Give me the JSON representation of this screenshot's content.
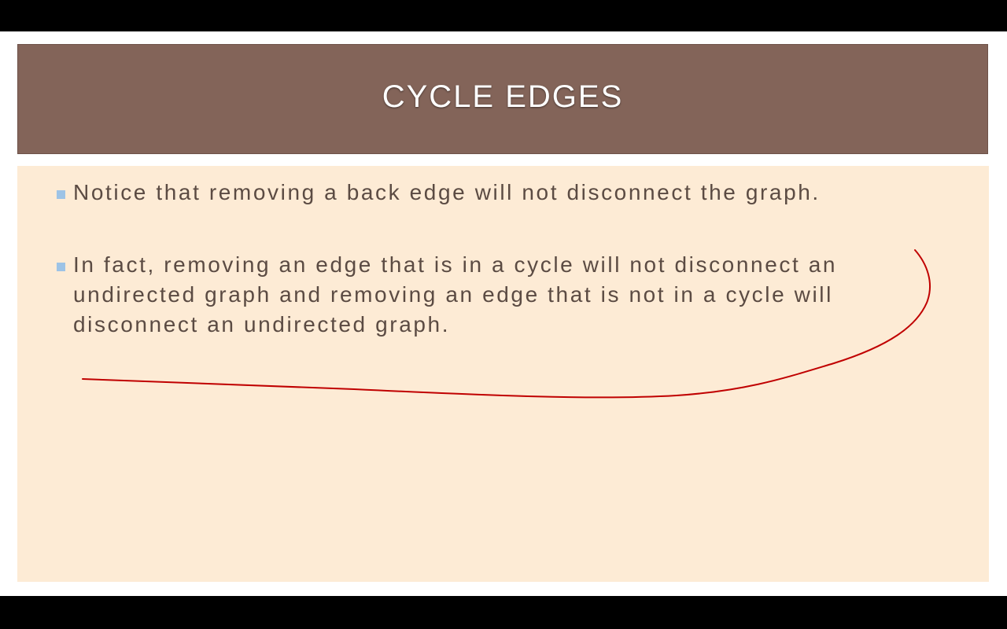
{
  "slide": {
    "title": "CYCLE EDGES",
    "bullets": [
      "Notice that removing a back edge will not disconnect the graph.",
      "In fact, removing an edge that is in a cycle will not disconnect an undirected graph and removing an edge that is not in a cycle will disconnect an undirected graph."
    ]
  },
  "colors": {
    "title_bg": "#836459",
    "content_bg": "#fdebd5",
    "bullet": "#9dc3e6",
    "annotation": "#c00000"
  }
}
